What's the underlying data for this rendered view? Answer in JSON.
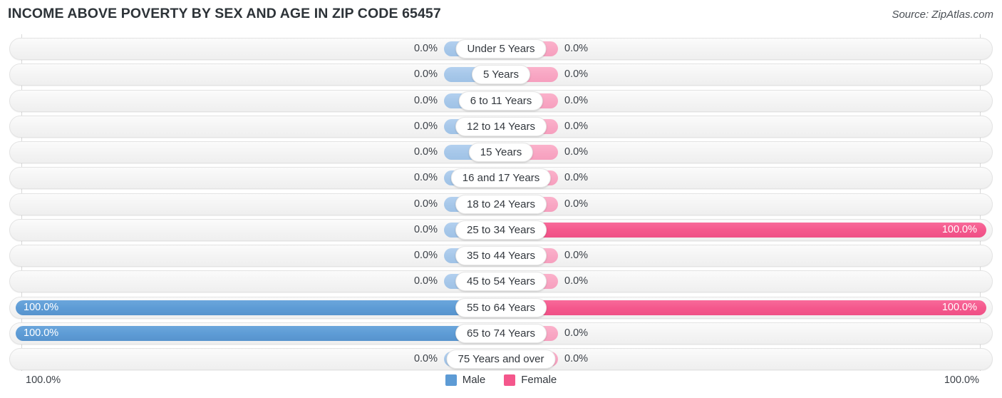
{
  "header": {
    "title": "INCOME ABOVE POVERTY BY SEX AND AGE IN ZIP CODE 65457",
    "source": "Source: ZipAtlas.com"
  },
  "legend": {
    "male_label": "Male",
    "female_label": "Female",
    "male_color": "#5d9bd5",
    "female_color": "#f4578c"
  },
  "axis": {
    "left_label": "100.0%",
    "right_label": "100.0%"
  },
  "chart_data": {
    "type": "bar",
    "title": "INCOME ABOVE POVERTY BY SEX AND AGE IN ZIP CODE 65457",
    "subtitle": "Source: ZipAtlas.com",
    "orientation": "horizontal-diverging",
    "xlabel": "",
    "ylabel": "",
    "xlim": [
      0,
      100
    ],
    "grid": true,
    "legend_position": "bottom-center",
    "categories": [
      "Under 5 Years",
      "5 Years",
      "6 to 11 Years",
      "12 to 14 Years",
      "15 Years",
      "16 and 17 Years",
      "18 to 24 Years",
      "25 to 34 Years",
      "35 to 44 Years",
      "45 to 54 Years",
      "55 to 64 Years",
      "65 to 74 Years",
      "75 Years and over"
    ],
    "series": [
      {
        "name": "Male",
        "values": [
          0.0,
          0.0,
          0.0,
          0.0,
          0.0,
          0.0,
          0.0,
          0.0,
          0.0,
          0.0,
          100.0,
          100.0,
          0.0
        ],
        "labels": [
          "0.0%",
          "0.0%",
          "0.0%",
          "0.0%",
          "0.0%",
          "0.0%",
          "0.0%",
          "0.0%",
          "0.0%",
          "0.0%",
          "100.0%",
          "100.0%",
          "0.0%"
        ]
      },
      {
        "name": "Female",
        "values": [
          0.0,
          0.0,
          0.0,
          0.0,
          0.0,
          0.0,
          0.0,
          100.0,
          0.0,
          0.0,
          100.0,
          0.0,
          0.0
        ],
        "labels": [
          "0.0%",
          "0.0%",
          "0.0%",
          "0.0%",
          "0.0%",
          "0.0%",
          "0.0%",
          "100.0%",
          "0.0%",
          "0.0%",
          "100.0%",
          "0.0%",
          "0.0%"
        ]
      }
    ]
  },
  "rows": [
    {
      "label": "Under 5 Years",
      "male": "0.0%",
      "female": "0.0%",
      "male_pct": 0,
      "female_pct": 0
    },
    {
      "label": "5 Years",
      "male": "0.0%",
      "female": "0.0%",
      "male_pct": 0,
      "female_pct": 0
    },
    {
      "label": "6 to 11 Years",
      "male": "0.0%",
      "female": "0.0%",
      "male_pct": 0,
      "female_pct": 0
    },
    {
      "label": "12 to 14 Years",
      "male": "0.0%",
      "female": "0.0%",
      "male_pct": 0,
      "female_pct": 0
    },
    {
      "label": "15 Years",
      "male": "0.0%",
      "female": "0.0%",
      "male_pct": 0,
      "female_pct": 0
    },
    {
      "label": "16 and 17 Years",
      "male": "0.0%",
      "female": "0.0%",
      "male_pct": 0,
      "female_pct": 0
    },
    {
      "label": "18 to 24 Years",
      "male": "0.0%",
      "female": "0.0%",
      "male_pct": 0,
      "female_pct": 0
    },
    {
      "label": "25 to 34 Years",
      "male": "0.0%",
      "female": "100.0%",
      "male_pct": 0,
      "female_pct": 100
    },
    {
      "label": "35 to 44 Years",
      "male": "0.0%",
      "female": "0.0%",
      "male_pct": 0,
      "female_pct": 0
    },
    {
      "label": "45 to 54 Years",
      "male": "0.0%",
      "female": "0.0%",
      "male_pct": 0,
      "female_pct": 0
    },
    {
      "label": "55 to 64 Years",
      "male": "100.0%",
      "female": "100.0%",
      "male_pct": 100,
      "female_pct": 100
    },
    {
      "label": "65 to 74 Years",
      "male": "100.0%",
      "female": "0.0%",
      "male_pct": 100,
      "female_pct": 0
    },
    {
      "label": "75 Years and over",
      "male": "0.0%",
      "female": "0.0%",
      "male_pct": 0,
      "female_pct": 0
    }
  ]
}
